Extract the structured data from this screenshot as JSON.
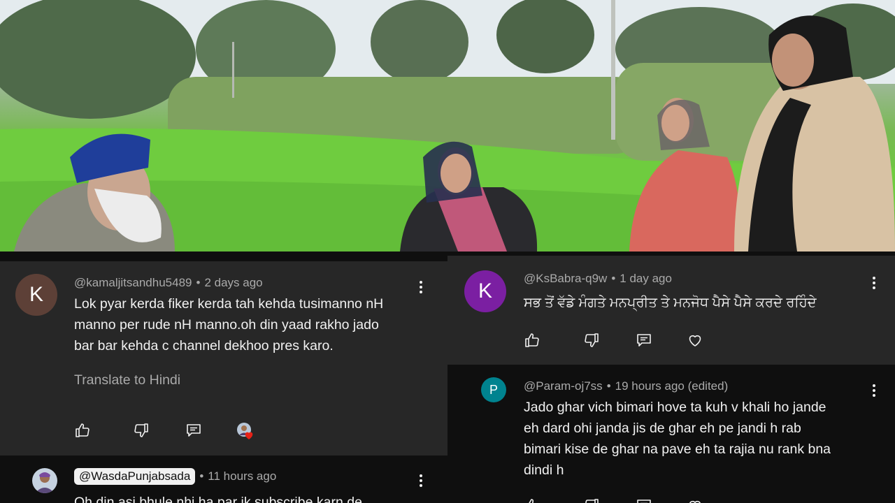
{
  "video": {
    "scene": "Punjabi village field conversation"
  },
  "left_panel": {
    "comment1": {
      "avatar_letter": "K",
      "avatar_color": "#5d4037",
      "author": "@kamaljitsandhu5489",
      "time": "2 days ago",
      "text_lines": [
        "Lok pyar kerda fiker kerda tah kehda tusimanno nH",
        "manno per rude nH manno.oh din yaad rakho jado",
        "bar bar kehda c channel dekhoo pres karo."
      ],
      "translate": "Translate to Hindi"
    },
    "comment2": {
      "author_mention": "@WasdaPunjabsada",
      "time": "11 hours ago",
      "text_partial": "Oh din asi bhule nhi ha par ik subscribe karn de"
    }
  },
  "right_panel": {
    "comment1": {
      "avatar_letter": "K",
      "avatar_color": "#7b1fa2",
      "author": "@KsBabra-q9w",
      "time": "1 day ago",
      "text": "ਸਭ ਤੋਂ ਵੱਡੇ ਮੰਗਤੇ ਮਨਪ੍ਰੀਤ ਤੇ ਮਨਜੋਧ  ਪੈਸੇ  ਪੈਸੇ ਕਰਦੇ ਰਹਿੰਦੇ"
    },
    "reply1": {
      "avatar_letter": "P",
      "avatar_color": "#00838f",
      "author": "@Param-oj7ss",
      "time": "19 hours ago (edited)",
      "text_lines": [
        "Jado ghar vich bimari hove ta kuh v khali ho jande",
        "eh dard ohi janda jis de ghar eh pe jandi h rab",
        "bimari kise de ghar na pave eh ta rajia nu rank bna",
        "dindi h"
      ]
    }
  },
  "colors": {
    "bg": "#0f0f0f",
    "card": "#272727",
    "meta": "#aaaaaa",
    "text": "#f1f1f1",
    "heart": "#e62117"
  },
  "icons": [
    "like-icon",
    "dislike-icon",
    "reply-icon",
    "heart-icon",
    "more-vert-icon"
  ]
}
